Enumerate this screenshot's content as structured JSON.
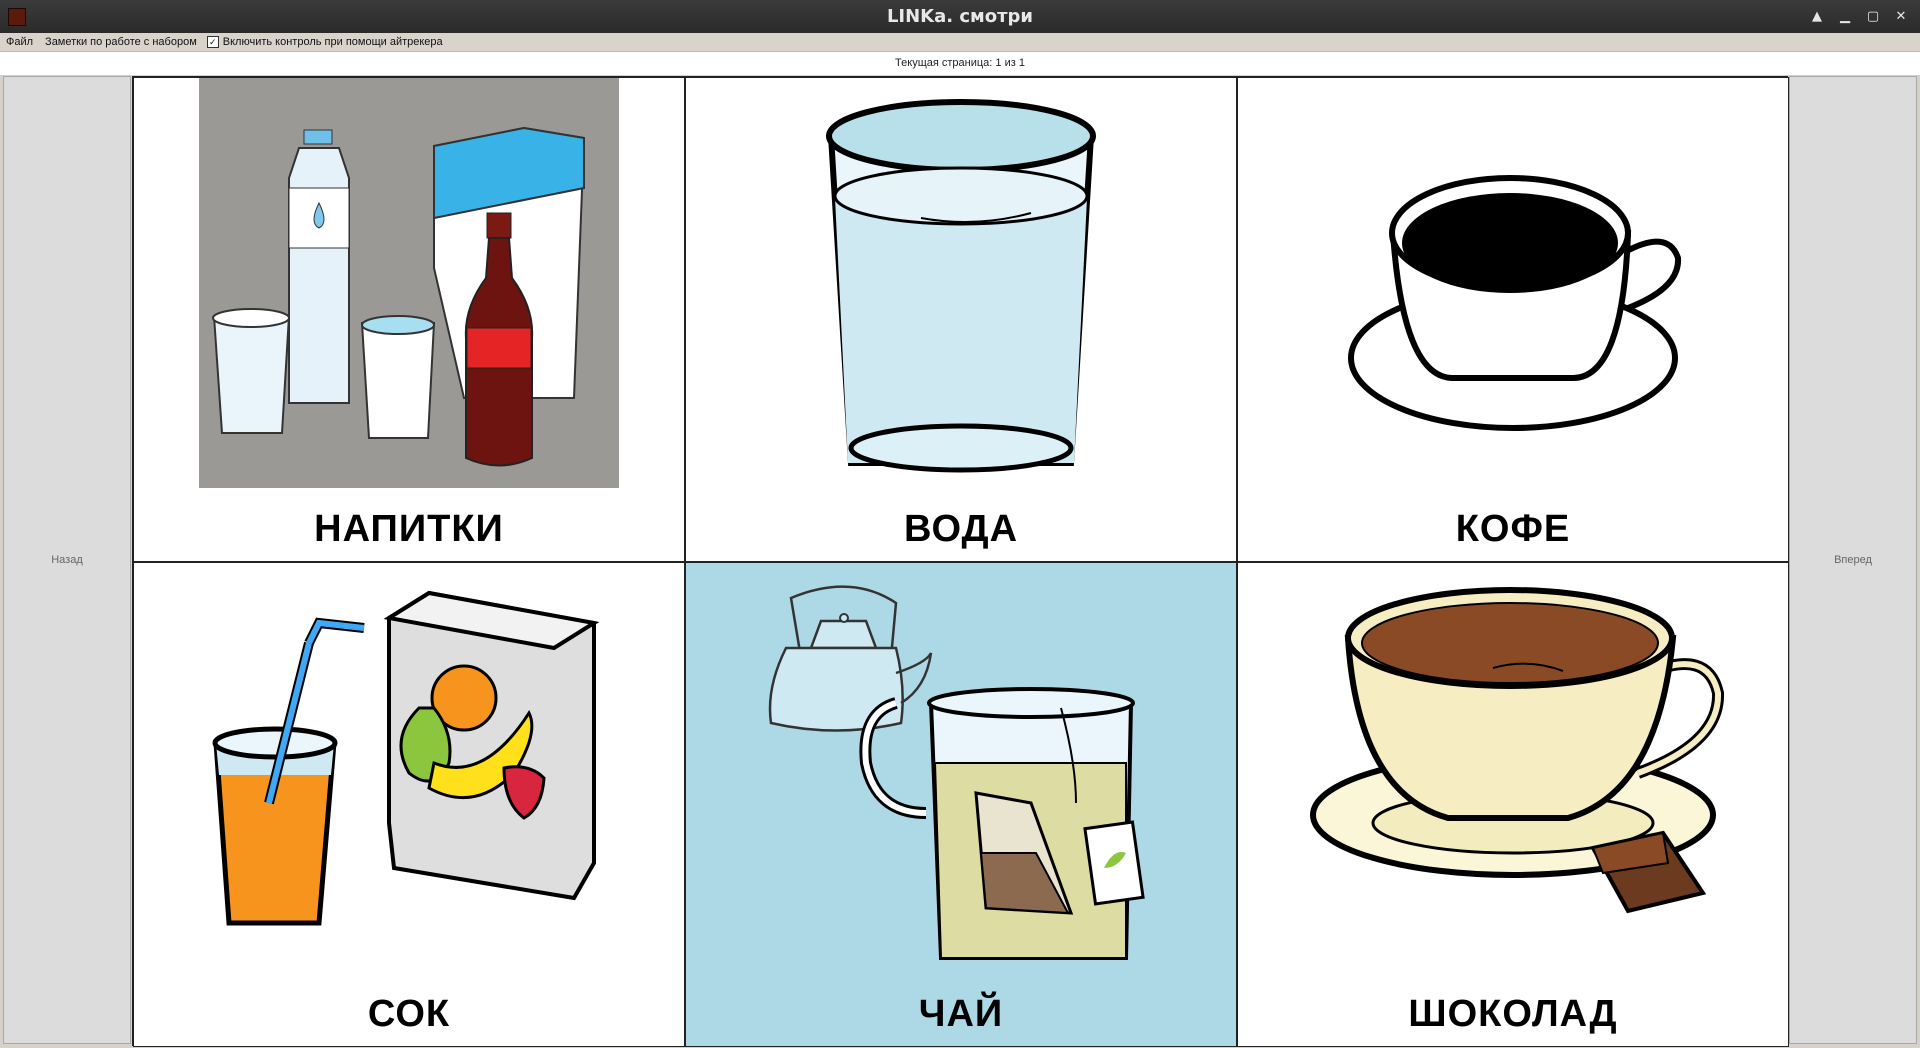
{
  "window": {
    "title": "LINKa. смотри"
  },
  "menu": {
    "file": "Файл",
    "notes": "Заметки по работе с набором",
    "eyetracker_label": "Включить контроль при помощи айтрекера",
    "eyetracker_checked": true,
    "checkmark": "✓"
  },
  "status": {
    "page_text": "Текущая страница: 1 из 1"
  },
  "nav": {
    "back": "Назад",
    "forward": "Вперед"
  },
  "cards": [
    {
      "label": "НАПИТКИ",
      "selected": false
    },
    {
      "label": "ВОДА",
      "selected": false
    },
    {
      "label": "КОФЕ",
      "selected": false
    },
    {
      "label": "СОК",
      "selected": false
    },
    {
      "label": "ЧАЙ",
      "selected": true
    },
    {
      "label": "ШОКОЛАД",
      "selected": false
    }
  ],
  "colors": {
    "selected_card": "#add8e6",
    "titlebar": "#2e2e2e"
  }
}
